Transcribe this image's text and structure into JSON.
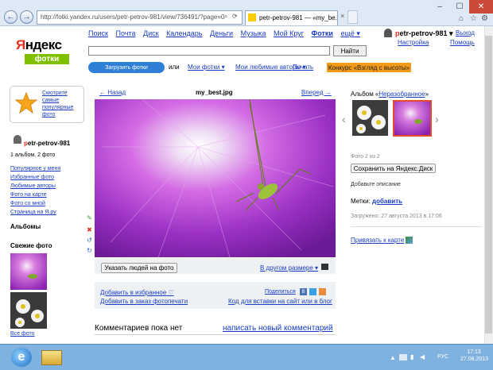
{
  "browser": {
    "address": "http://fotki.yandex.ru/users/petr-petrov-981/view/736491/?page=0",
    "tab_title": "petr-petrov-981 — «my_be..."
  },
  "topnav": [
    "Поиск",
    "Почта",
    "Диск",
    "Календарь",
    "Деньги",
    "Музыка",
    "Мой Круг",
    "Фотки",
    "ещё ▾"
  ],
  "user": {
    "name": "petr-petrov-981 ▾",
    "logout": "Выход",
    "settings": "Настройка",
    "help": "Помощь"
  },
  "logo": {
    "yandex": "Яндекс",
    "fotki": "фотки"
  },
  "search": {
    "value": "",
    "button": "Найти"
  },
  "subnav": {
    "upload": "Загрузить фотки",
    "or": "или",
    "my_photos": "Мои фотки ▾",
    "fav_authors": "Мои любимые авторы ▾",
    "print": "Печать",
    "contest": "Конкурс «Взгляд с высоты»"
  },
  "left": {
    "popular_lines": [
      "Смотрите",
      "самые",
      "популярные",
      "фото"
    ],
    "profile_name": "petr-petrov-981",
    "profile_stats": "1 альбом, 2 фото",
    "links": [
      "Популярное у меня",
      "Избранные фото",
      "Любимые авторы",
      "Фото на карте",
      "Фото со мной",
      "Страница на Я.ру"
    ],
    "albums": "Альбомы",
    "fresh": "Свежие фото",
    "all_photos": "Все фото"
  },
  "viewer": {
    "prev": "← Назад",
    "title": "my_best.jpg",
    "next": "Вперед →",
    "tag_people": "Указать людей на фото",
    "other_size": "В другом размере ▾",
    "add_fav": "Добавить в избранное ♡",
    "add_print": "Добавить в заказ фотопечати",
    "share": "Поделиться",
    "embed": "Код для вставки на сайт или в блог",
    "no_comments": "Комментариев пока нет",
    "write_comment": "написать новый комментарий"
  },
  "right": {
    "album_prefix": "Альбом «",
    "album_name": "Неразобранное",
    "album_suffix": "»",
    "counter": "Фото 2 из 2",
    "save_disk": "Сохранить на Яндекс.Диск",
    "add_desc": "Добавьте описание",
    "tags_label": "Метки:",
    "tags_add": "добавить",
    "uploaded": "Загружено: 27 августа 2013 в 17:06",
    "map": "Привязать к карте"
  },
  "taskbar": {
    "lang": "РУС",
    "time": "17:13",
    "date": "27.08.2013"
  },
  "colors": {
    "brand_red": "#e62e1e",
    "link": "#1a3dc1",
    "contest": "#f39a18",
    "accent_green": "#7fbf00"
  }
}
